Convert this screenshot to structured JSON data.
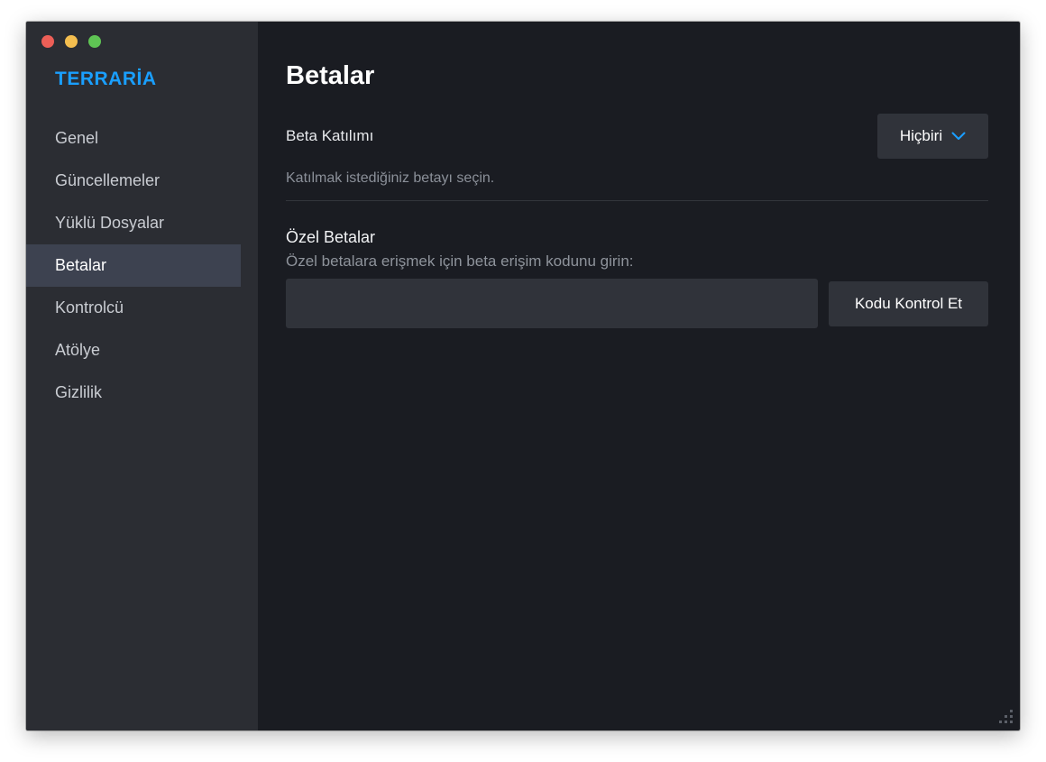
{
  "app": {
    "title": "TERRARİA"
  },
  "window_controls": [
    "close",
    "minimize",
    "zoom"
  ],
  "sidebar": {
    "items": [
      {
        "label": "Genel",
        "active": false
      },
      {
        "label": "Güncellemeler",
        "active": false
      },
      {
        "label": "Yüklü Dosyalar",
        "active": false
      },
      {
        "label": "Betalar",
        "active": true
      },
      {
        "label": "Kontrolcü",
        "active": false
      },
      {
        "label": "Atölye",
        "active": false
      },
      {
        "label": "Gizlilik",
        "active": false
      }
    ]
  },
  "main": {
    "title": "Betalar",
    "beta_participation": {
      "label": "Beta Katılımı",
      "selected": "Hiçbiri",
      "hint": "Katılmak istediğiniz betayı seçin."
    },
    "private_betas": {
      "title": "Özel Betalar",
      "description": "Özel betalara erişmek için beta erişim kodunu girin:",
      "input_value": "",
      "input_placeholder": "",
      "button_label": "Kodu Kontrol Et"
    }
  },
  "colors": {
    "accent": "#1a9fff",
    "sidebar_bg": "#2b2d33",
    "main_bg": "#1a1c22",
    "active_item_bg": "#3d4250",
    "control_bg": "#30333a"
  },
  "icons": {
    "dropdown": "chevron-down-icon",
    "resize": "resize-grip-icon"
  }
}
